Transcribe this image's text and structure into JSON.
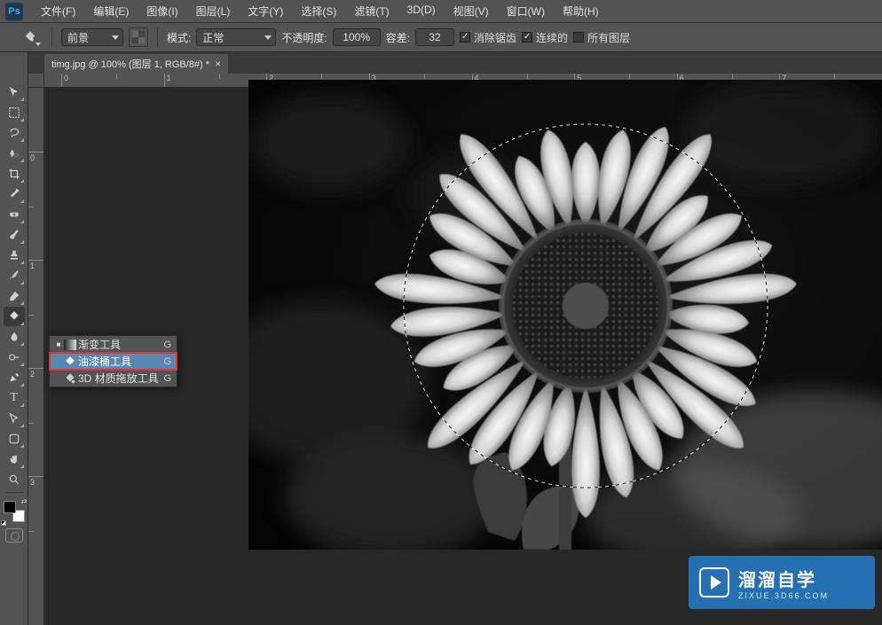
{
  "menubar": {
    "items": [
      "文件(F)",
      "编辑(E)",
      "图像(I)",
      "图层(L)",
      "文字(Y)",
      "选择(S)",
      "滤镜(T)",
      "3D(D)",
      "视图(V)",
      "窗口(W)",
      "帮助(H)"
    ]
  },
  "options": {
    "fill_source": "前景",
    "mode_label": "模式:",
    "mode_value": "正常",
    "opacity_label": "不透明度:",
    "opacity_value": "100%",
    "tolerance_label": "容差:",
    "tolerance_value": "32",
    "antialias_label": "消除锯齿",
    "contiguous_label": "连续的",
    "all_layers_label": "所有图层"
  },
  "tab": {
    "title": "timg.jpg @ 100% (图层 1, RGB/8#) *",
    "close": "×"
  },
  "hruler": [
    "0",
    "1",
    "2",
    "3",
    "4",
    "5",
    "6",
    "7"
  ],
  "vruler": [
    "0",
    "1",
    "2",
    "3"
  ],
  "flyout": {
    "items": [
      {
        "label": "渐变工具",
        "key": "G"
      },
      {
        "label": "油漆桶工具",
        "key": "G"
      },
      {
        "label": "3D 材质拖放工具",
        "key": "G"
      }
    ]
  },
  "watermark": {
    "title": "溜溜自学",
    "sub": "ZIXUE.3D66.COM"
  }
}
